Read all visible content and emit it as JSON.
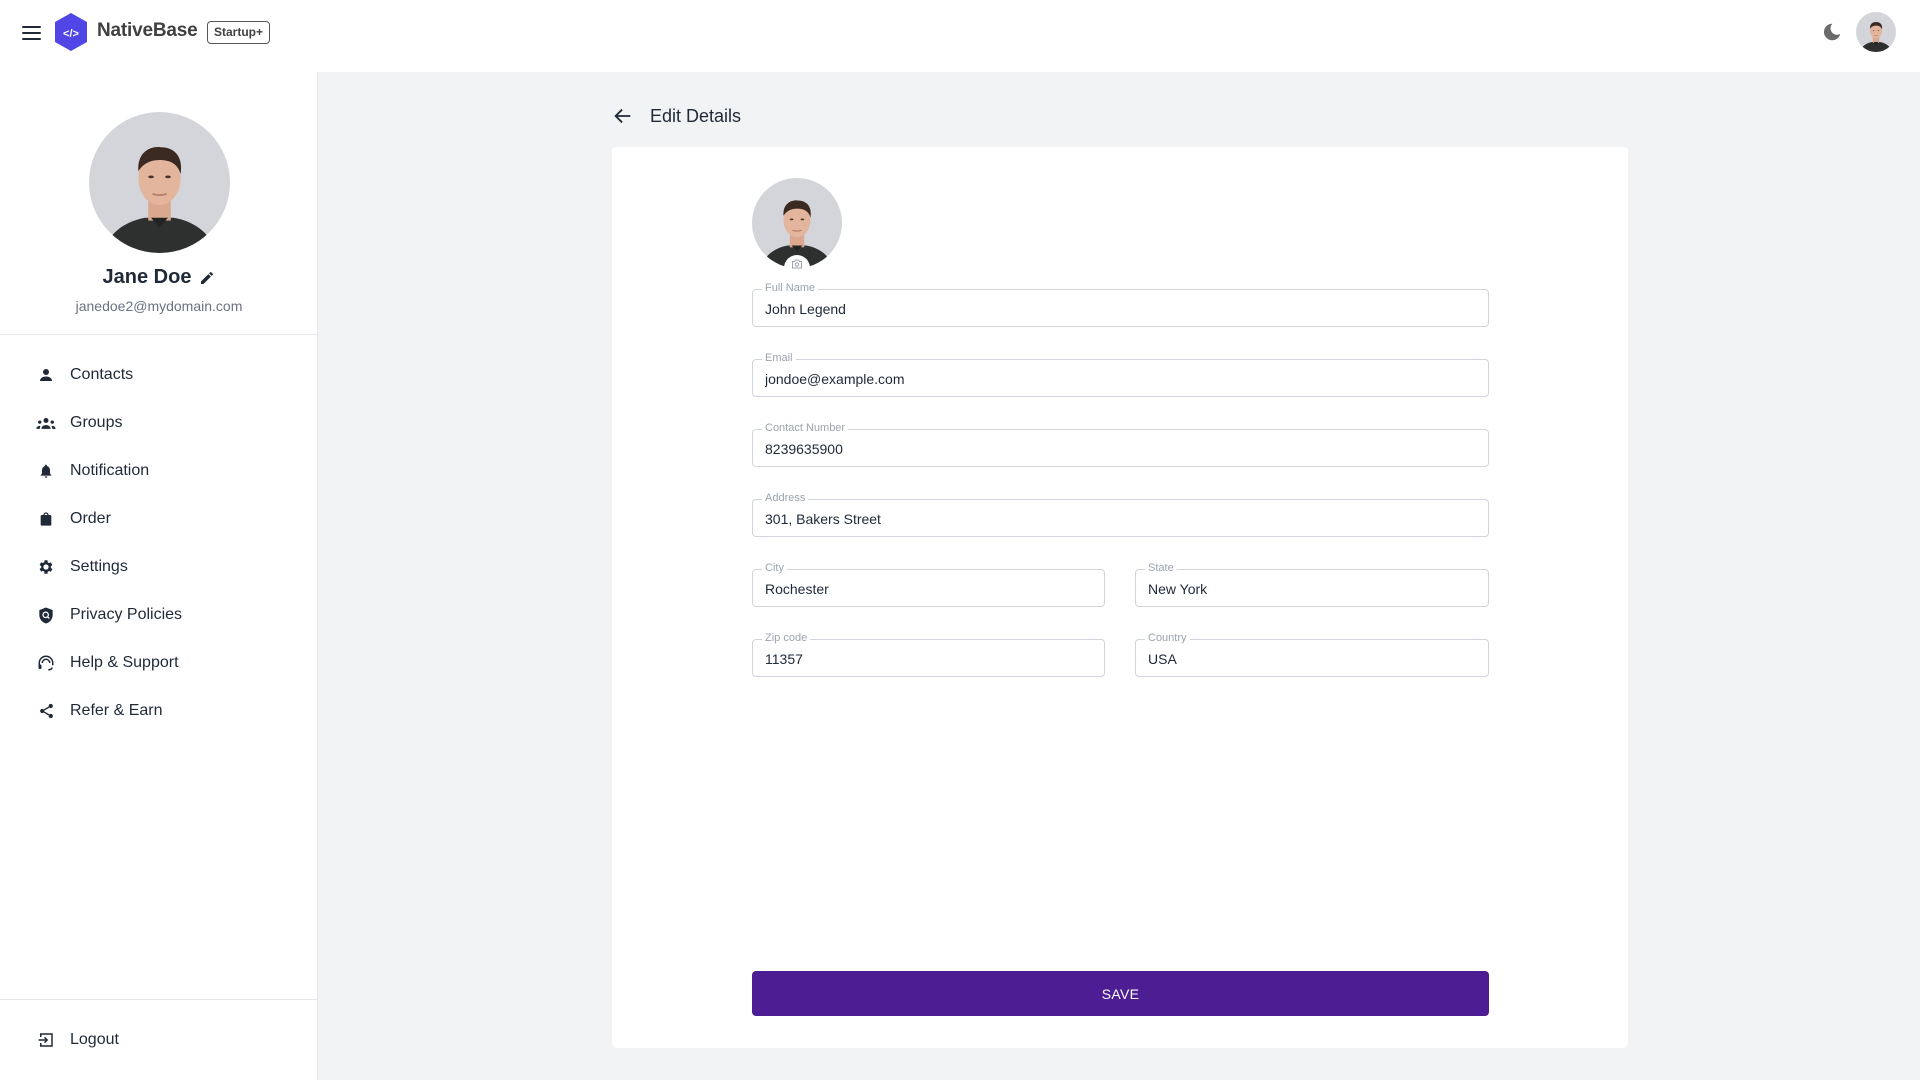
{
  "header": {
    "brand": "NativeBase",
    "badge": "Startup+",
    "logo_glyph": "</>",
    "icons": {
      "menu": "hamburger-icon",
      "theme": "moon-icon",
      "avatar": "user-avatar"
    }
  },
  "sidebar": {
    "profile": {
      "name": "Jane Doe",
      "email": "janedoe2@mydomain.com"
    },
    "items": [
      {
        "label": "Contacts",
        "icon": "person-icon"
      },
      {
        "label": "Groups",
        "icon": "groups-icon"
      },
      {
        "label": "Notification",
        "icon": "bell-icon"
      },
      {
        "label": "Order",
        "icon": "shopping-bag-icon"
      },
      {
        "label": "Settings",
        "icon": "gear-icon"
      },
      {
        "label": "Privacy Policies",
        "icon": "shield-search-icon"
      },
      {
        "label": "Help & Support",
        "icon": "headset-icon"
      },
      {
        "label": "Refer & Earn",
        "icon": "share-icon"
      }
    ],
    "logout": {
      "label": "Logout",
      "icon": "logout-icon"
    }
  },
  "main": {
    "title": "Edit Details",
    "form": {
      "full_name": {
        "label": "Full Name",
        "value": "John Legend"
      },
      "email": {
        "label": "Email",
        "value": "jondoe@example.com"
      },
      "contact": {
        "label": "Contact Number",
        "value": "8239635900"
      },
      "address": {
        "label": "Address",
        "value": "301, Bakers Street"
      },
      "city": {
        "label": "City",
        "value": "Rochester"
      },
      "state": {
        "label": "State",
        "value": "New York"
      },
      "zip": {
        "label": "Zip code",
        "value": "11357"
      },
      "country": {
        "label": "Country",
        "value": "USA"
      }
    },
    "save_label": "SAVE"
  },
  "colors": {
    "primary": "#4d1e93",
    "logo": "#4f46e5",
    "background": "#f2f3f5",
    "text": "#1f2937"
  }
}
